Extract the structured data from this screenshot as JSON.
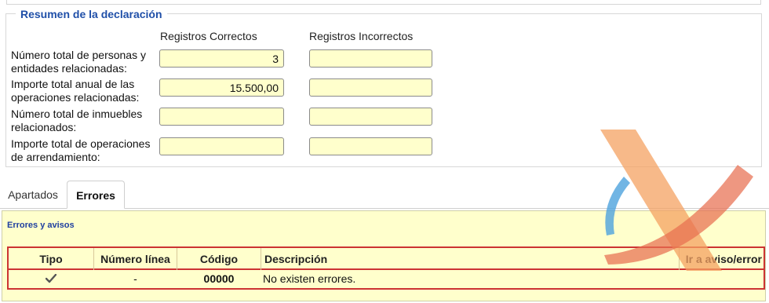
{
  "resumen": {
    "legend": "Resumen de la declaración",
    "col_correctos": "Registros Correctos",
    "col_incorrectos": "Registros Incorrectos",
    "rows": [
      {
        "label_1": "Número total de personas y",
        "label_2": "entidades relacionadas:",
        "correctos": "3",
        "incorrectos": ""
      },
      {
        "label_1": "Importe total anual de las",
        "label_2": "operaciones relacionadas:",
        "correctos": "15.500,00",
        "incorrectos": ""
      },
      {
        "label_1": "Número total de inmuebles",
        "label_2": "relacionados:",
        "correctos": "",
        "incorrectos": ""
      },
      {
        "label_1": "Importe total de operaciones",
        "label_2": "de arrendamiento:",
        "correctos": "",
        "incorrectos": ""
      }
    ]
  },
  "tabs": [
    {
      "label": "Apartados"
    },
    {
      "label": "Errores"
    }
  ],
  "errores": {
    "title": "Errores y avisos",
    "headers": {
      "tipo": "Tipo",
      "numero_linea": "Número línea",
      "codigo": "Código",
      "descripcion": "Descripción",
      "ir_a": "Ir a aviso/error"
    },
    "row": {
      "tipo_icon": "check-icon",
      "numero_linea": "-",
      "codigo": "00000",
      "descripcion": "No existen errores."
    }
  },
  "colors": {
    "legend_blue": "#1f4fa8",
    "field_yellow": "#ffffcc",
    "error_red": "#cc3333",
    "logo_orange": "#f4a261",
    "logo_red": "#e76f51",
    "logo_blue": "#4ea3dd"
  }
}
